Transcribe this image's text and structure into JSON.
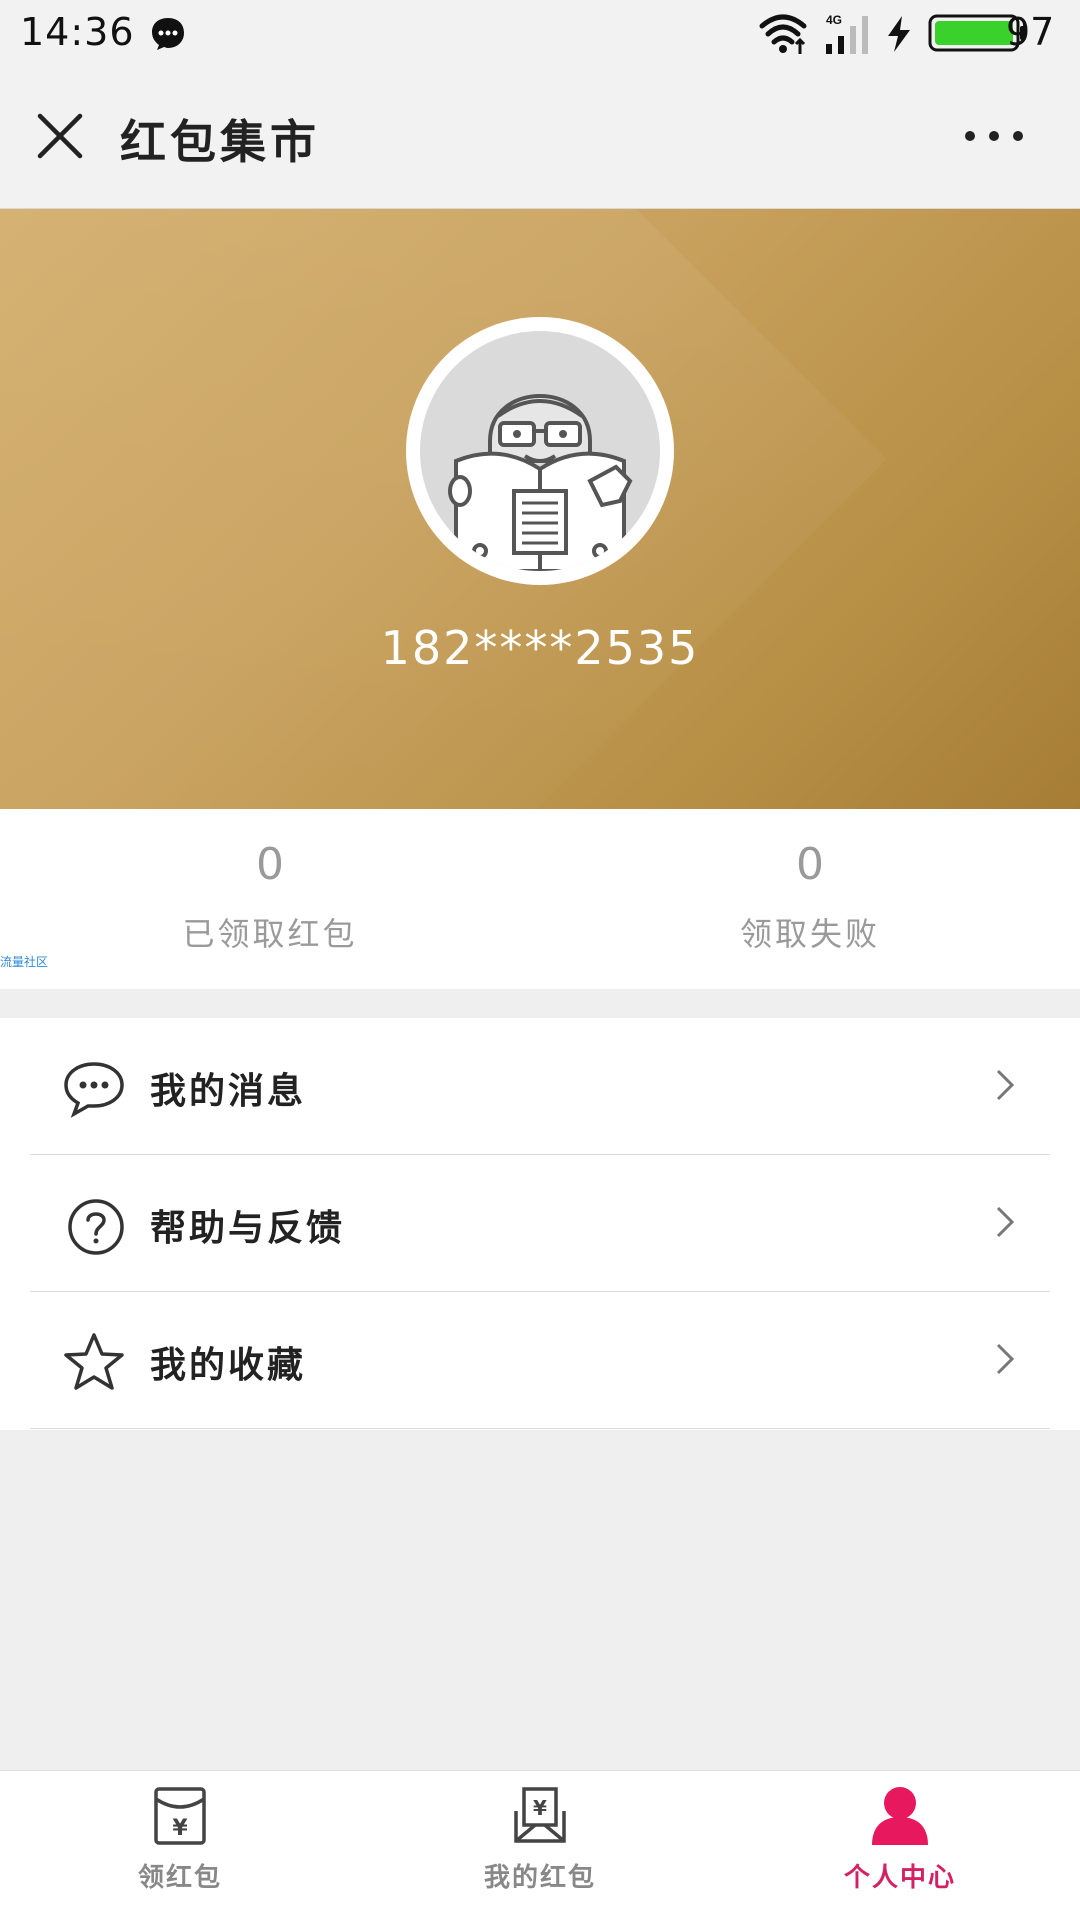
{
  "status_bar": {
    "time": "14:36",
    "network": "4G",
    "battery_level": "97",
    "icons": [
      "chat-bubble-icon",
      "wifi-icon",
      "signal-icon",
      "charging-icon",
      "battery-icon"
    ]
  },
  "nav": {
    "title": "红包集市",
    "close_icon": "close-icon",
    "more_icon": "more-icon"
  },
  "profile": {
    "username": "182****2535",
    "banner_colors": [
      "#d3ae6c",
      "#a77d35"
    ]
  },
  "stats": [
    {
      "value": "0",
      "label": "已领取红包"
    },
    {
      "value": "0",
      "label": "领取失败"
    }
  ],
  "watermark": "流量社区",
  "menu": [
    {
      "label": "我的消息",
      "icon": "message-icon"
    },
    {
      "label": "帮助与反馈",
      "icon": "help-icon"
    },
    {
      "label": "我的收藏",
      "icon": "star-icon"
    }
  ],
  "tabs": [
    {
      "label": "领红包",
      "icon": "red-packet-icon",
      "active": false
    },
    {
      "label": "我的红包",
      "icon": "my-red-packet-icon",
      "active": false
    },
    {
      "label": "个人中心",
      "icon": "user-icon",
      "active": true
    }
  ],
  "colors": {
    "accent": "#d42163",
    "muted_text": "#9a9a9a",
    "background": "#efefef"
  }
}
